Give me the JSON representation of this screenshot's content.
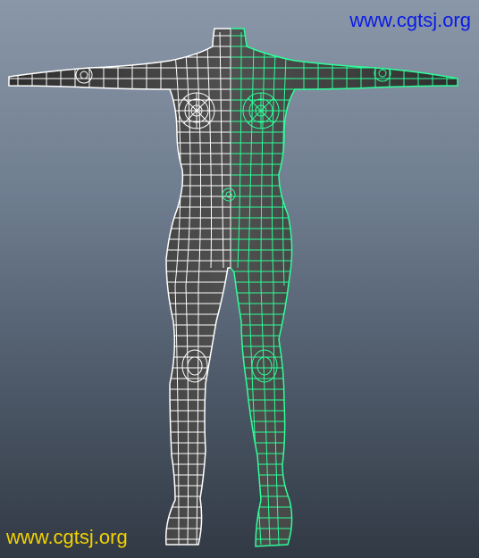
{
  "watermark": {
    "top_text": "www.cgtsj.org",
    "bottom_text": "www.cgtsj.org",
    "top_color": "#0a1be6",
    "bottom_color": "#f4d200"
  },
  "viewport": {
    "bg_top": "#8a97a8",
    "bg_bottom": "#313944"
  },
  "model": {
    "mesh_color": "#3a3a3a",
    "wire_unselected": "#ffffff",
    "wire_selected": "#2cff9a"
  }
}
